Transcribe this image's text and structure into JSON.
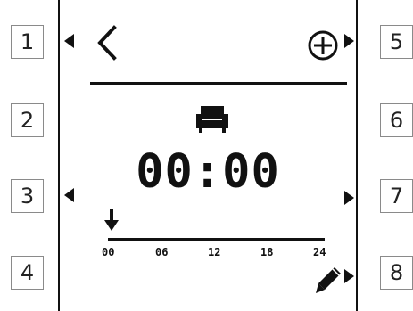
{
  "side_keys": {
    "left": [
      "1",
      "2",
      "3",
      "4"
    ],
    "right": [
      "5",
      "6",
      "7",
      "8"
    ]
  },
  "header": {
    "back_icon": "chevron-left-icon",
    "add_icon": "circle-plus-icon"
  },
  "mode_icon": "sofa-icon",
  "time_display": "00:00",
  "timeline": {
    "marker_icon": "down-arrow-icon",
    "ticks": [
      "00",
      "06",
      "12",
      "18",
      "24"
    ]
  },
  "edit_icon": "pencil-icon",
  "colors": {
    "ink": "#111111",
    "key_border": "#8a8a8a",
    "background": "#ffffff"
  }
}
